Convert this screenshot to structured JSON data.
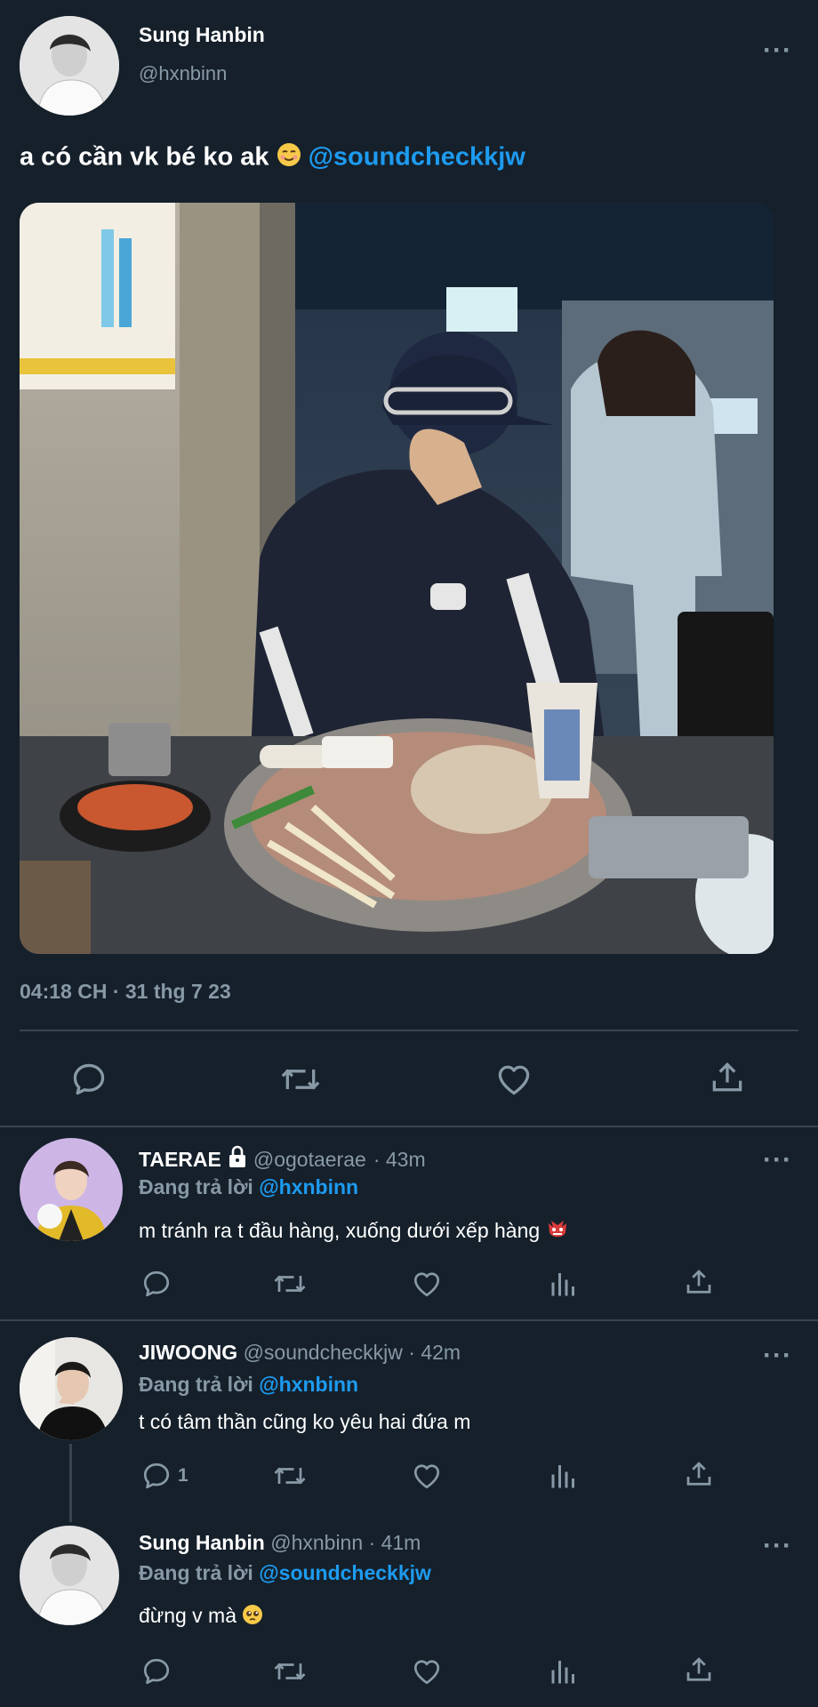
{
  "main_tweet": {
    "author_name": "Sung Hanbin",
    "author_handle": "@hxnbinn",
    "text": "a có cần vk bé ko ak",
    "mention": "@soundcheckkjw",
    "timestamp": "04:18 CH · 31 thg 7 23"
  },
  "replies": [
    {
      "name": "TAERAE",
      "handle": "@ogotaerae",
      "time": "· 43m",
      "replying_label": "Đang trả lời",
      "replying_to": "@hxnbinn",
      "text": "m tránh ra t đầu hàng, xuống dưới xếp hàng",
      "reply_count": ""
    },
    {
      "name": "JIWOONG",
      "handle": "@soundcheckkjw",
      "time": "· 42m",
      "replying_label": "Đang trả lời",
      "replying_to": "@hxnbinn",
      "text": "t có tâm thần cũng ko yêu hai đứa m",
      "reply_count": "1"
    },
    {
      "name": "Sung Hanbin",
      "handle": "@hxnbinn",
      "time": "· 41m",
      "replying_label": "Đang trả lời",
      "replying_to": "@soundcheckkjw",
      "text": "đừng v mà",
      "reply_count": ""
    }
  ],
  "colors": {
    "background": "#15202b",
    "accent": "#1d9bf0",
    "muted": "#8899a6",
    "divider": "#38444d"
  },
  "icons": [
    "more-icon",
    "reply-icon",
    "retweet-icon",
    "like-icon",
    "share-icon",
    "analytics-icon",
    "lock-icon"
  ]
}
